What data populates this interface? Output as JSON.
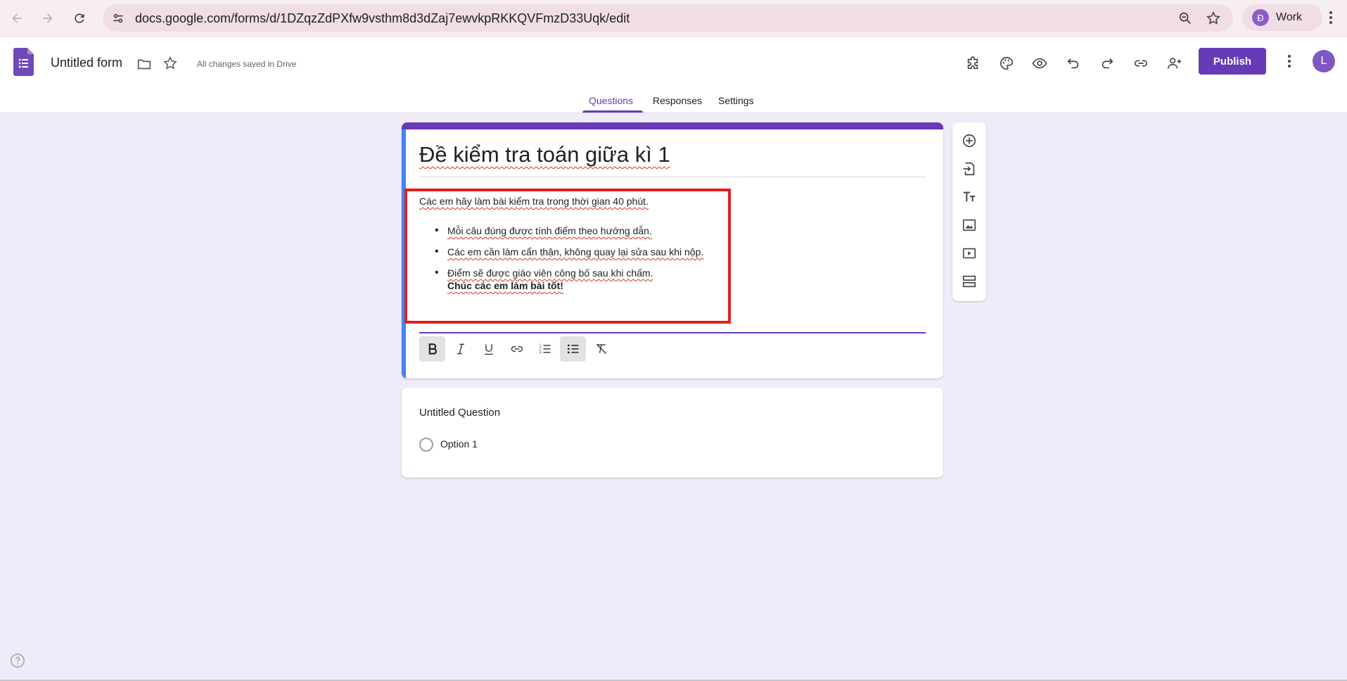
{
  "browser": {
    "url": "docs.google.com/forms/d/1DZqzZdPXfw9vsthm8d3dZaj7ewvkpRKKQVFmzD33Uqk/edit",
    "profile_initial": "Đ",
    "profile_name": "Work",
    "icons": [
      "back-icon",
      "forward-icon",
      "reload-icon",
      "site-info-icon",
      "zoom-icon",
      "bookmark-star-icon",
      "chrome-menu-icon"
    ]
  },
  "header": {
    "title": "Untitled form",
    "save_status": "All changes saved in Drive",
    "publish_label": "Publish",
    "user_initial": "L",
    "icons": [
      "add-ons-icon",
      "palette-icon",
      "preview-icon",
      "undo-icon",
      "redo-icon",
      "link-icon",
      "add-collaborator-icon",
      "more-vert-icon"
    ]
  },
  "tabs": [
    {
      "label": "Questions",
      "active": true
    },
    {
      "label": "Responses",
      "active": false
    },
    {
      "label": "Settings",
      "active": false
    }
  ],
  "form": {
    "title": "Đề kiểm tra toán giữa kì 1",
    "description": {
      "intro": "Các em hãy làm bài kiểm tra trong thời gian 40 phút.",
      "bullets": [
        "Mỗi câu đúng được tính điểm theo hướng dẫn.",
        "Các em cần làm cẩn thận, không quay lại sửa sau khi nộp.",
        "Điểm sẽ được giáo viên công bố sau khi chấm."
      ],
      "closing": "Chúc các em làm bài tốt!"
    },
    "toolbar": [
      "bold",
      "italic",
      "underline",
      "link",
      "numbered-list",
      "bulleted-list",
      "clear-formatting"
    ]
  },
  "side_toolbar": [
    "add-question",
    "import-questions",
    "add-title-description",
    "add-image",
    "add-video",
    "add-section"
  ],
  "question": {
    "title": "Untitled Question",
    "option": "Option 1"
  },
  "colors": {
    "accent": "#673ab7",
    "background": "#f0ebf8",
    "highlight_box": "#e02020"
  }
}
